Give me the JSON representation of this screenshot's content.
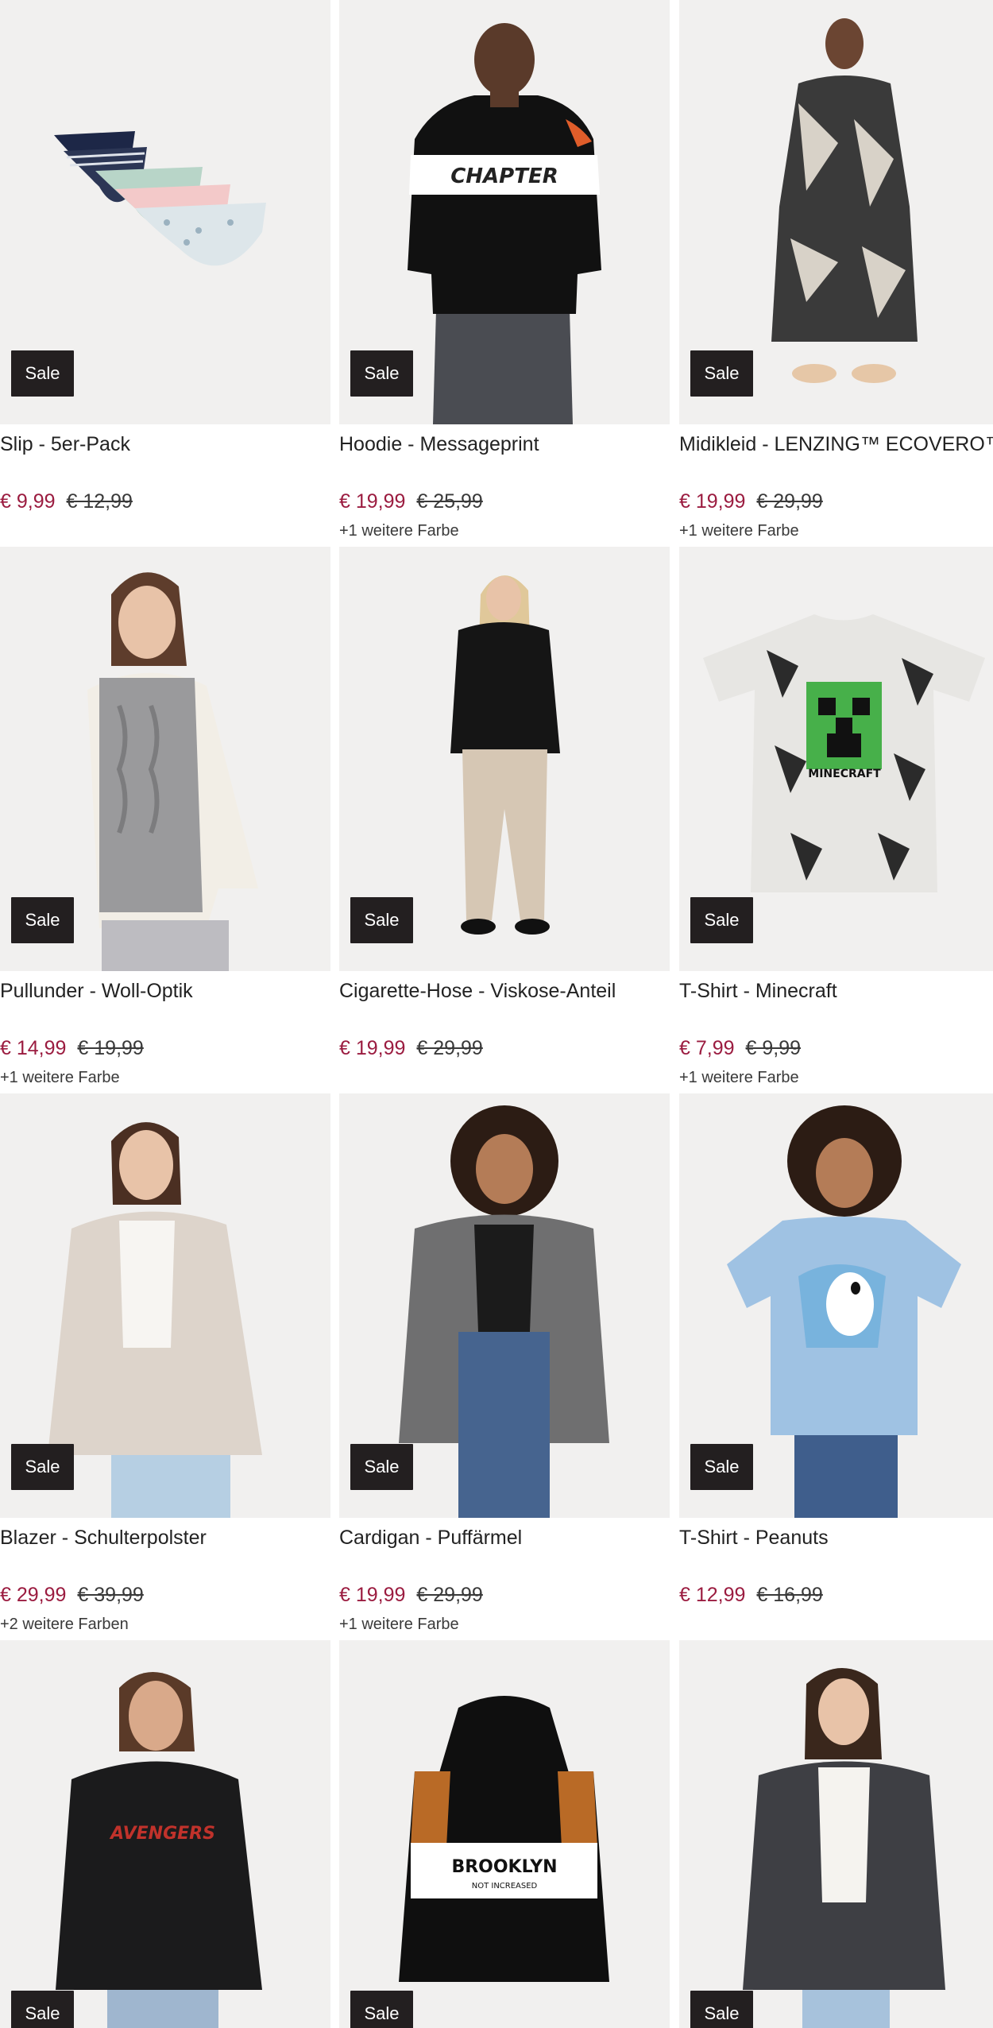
{
  "products": [
    {
      "title": "Slip - 5er-Pack",
      "badge": "Sale",
      "price": "€ 9,99",
      "old_price": "€ 12,99",
      "more_colors": "",
      "image_icon": "underwear-pack-icon"
    },
    {
      "title": "Hoodie - Messageprint",
      "badge": "Sale",
      "price": "€ 19,99",
      "old_price": "€ 25,99",
      "more_colors": "+1 weitere Farbe",
      "image_icon": "hoodie-icon",
      "print_text": "CHAPTER"
    },
    {
      "title": "Midikleid - LENZING™ ECOVERO™",
      "badge": "Sale",
      "price": "€ 19,99",
      "old_price": "€ 29,99",
      "more_colors": "+1 weitere Farbe",
      "image_icon": "dress-icon"
    },
    {
      "title": "Pullunder - Woll-Optik",
      "badge": "Sale",
      "price": "€ 14,99",
      "old_price": "€ 19,99",
      "more_colors": "+1 weitere Farbe",
      "image_icon": "vest-icon"
    },
    {
      "title": "Cigarette-Hose - Viskose-Anteil",
      "badge": "Sale",
      "price": "€ 19,99",
      "old_price": "€ 29,99",
      "more_colors": "",
      "image_icon": "trousers-icon"
    },
    {
      "title": "T-Shirt - Minecraft",
      "badge": "Sale",
      "price": "€ 7,99",
      "old_price": "€ 9,99",
      "more_colors": "+1 weitere Farbe",
      "image_icon": "tshirt-icon",
      "print_text": "MINECRAFT"
    },
    {
      "title": "Blazer - Schulterpolster",
      "badge": "Sale",
      "price": "€ 29,99",
      "old_price": "€ 39,99",
      "more_colors": "+2 weitere Farben",
      "image_icon": "blazer-icon"
    },
    {
      "title": "Cardigan - Puffärmel",
      "badge": "Sale",
      "price": "€ 19,99",
      "old_price": "€ 29,99",
      "more_colors": "+1 weitere Farbe",
      "image_icon": "cardigan-icon"
    },
    {
      "title": "T-Shirt - Peanuts",
      "badge": "Sale",
      "price": "€ 12,99",
      "old_price": "€ 16,99",
      "more_colors": "",
      "image_icon": "tshirt-icon"
    },
    {
      "title": "",
      "badge": "Sale",
      "price": "",
      "old_price": "",
      "more_colors": "",
      "image_icon": "hoodie-icon",
      "print_text": "AVENGERS"
    },
    {
      "title": "",
      "badge": "Sale",
      "price": "",
      "old_price": "",
      "more_colors": "",
      "image_icon": "hoodie-icon",
      "print_text": "BROOKLYN",
      "print_subtext": "NOT INCREASED"
    },
    {
      "title": "",
      "badge": "Sale",
      "price": "",
      "old_price": "",
      "more_colors": "",
      "image_icon": "blazer-icon"
    }
  ],
  "colors": {
    "sale_price": "#9b1c40",
    "badge_bg": "#231f20",
    "image_bg": "#f1f0ef"
  }
}
